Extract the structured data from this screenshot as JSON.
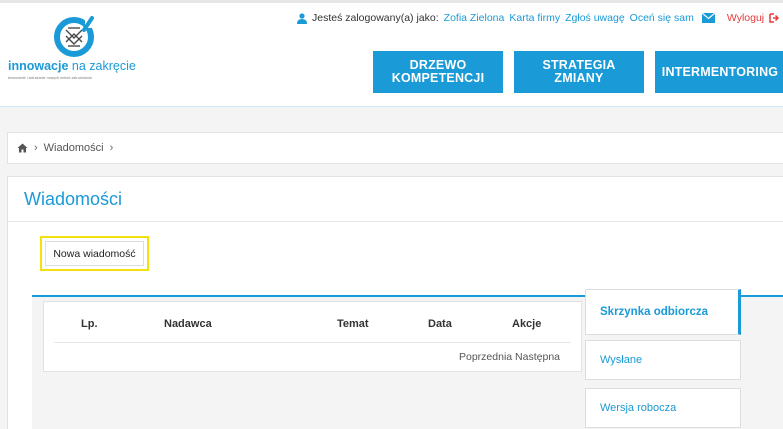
{
  "header": {
    "logo_bold": "innowacje",
    "logo_light": " na zakręcie",
    "logo_tagline": "testowanie i wdrażanie nowych metod zatrudniania"
  },
  "userbar": {
    "logged_as_text": "Jesteś zalogowany(a) jako:",
    "user_name": "Zofia Zielona",
    "company_card": "Karta firmy",
    "report_issue": "Zgłoś uwagę",
    "self_rate": "Oceń się sam",
    "logout": "Wyloguj"
  },
  "nav": {
    "btn1_line1": "DRZEWO",
    "btn1_line2": "KOMPETENCJI",
    "btn2_line1": "STRATEGIA",
    "btn2_line2": "ZMIANY",
    "btn3": "INTERMENTORING"
  },
  "breadcrumb": {
    "item": "Wiadomości",
    "sep": "›"
  },
  "page": {
    "title": "Wiadomości",
    "new_message_button": "Nowa wiadomość"
  },
  "table": {
    "columns": [
      "Lp.",
      "Nadawca",
      "Temat",
      "Data",
      "Akcje"
    ],
    "pager_prev": "Poprzednia",
    "pager_next": "Następna"
  },
  "tabs": [
    "Skrzynka odbiorcza",
    "Wysłane",
    "Wersja robocza"
  ],
  "colors": {
    "accent": "#1a9ad6",
    "highlight": "#f2e10f",
    "logout": "#e83a3a"
  }
}
